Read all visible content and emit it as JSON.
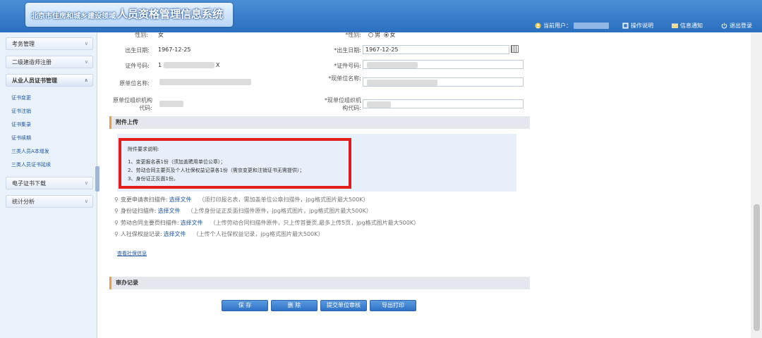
{
  "header": {
    "title_small": "北京市住房和城乡建设领域",
    "title_big": "人员资格管理信息系统",
    "current_user_label": "当前用户：",
    "help_label": "操作说明",
    "notice_label": "信息通知",
    "logout_label": "退出登录"
  },
  "sidebar": {
    "exam": "考务管理",
    "builder": "二级建造师注册",
    "cert_mgmt": "从业人员证书管理",
    "sub": [
      "证书变更",
      "证书注销",
      "证书集录",
      "证书续期",
      "三类人员A本增发",
      "三类人员证书延续"
    ],
    "e_cert": "电子证书下载",
    "stats": "统计分析"
  },
  "form": {
    "gender_label": "性别:",
    "gender_value": "女",
    "gender_label2": "*性别:",
    "male": "男",
    "female": "女",
    "birth_label": "出生日期:",
    "birth_value": "1967-12-25",
    "birth_label2": "*出生日期:",
    "birth_field": "1967-12-25",
    "id_label": "证件号码:",
    "id_value_start": "1",
    "id_value_end": "X",
    "id_label2": "*证件号码:",
    "orig_unit_label": "原单位名称:",
    "cur_unit_label": "*现单位名称:",
    "orig_org_label": "原单位组织机构代码:",
    "cur_org_label": "*现单位组织机构代码:"
  },
  "attach": {
    "section_title": "附件上传",
    "note_title": "附件要求说明:",
    "notes": [
      "1、变更报名表1份（须加盖聘用单位公章）；",
      "2、劳动合同主要页及个人社保权益记录各1份（需京变更和注销证书无需提供）；",
      "3、身份证正反面1份。"
    ],
    "rows": [
      {
        "label": "变更申请表扫描件:",
        "pick": "选择文件",
        "hint": "（须打印报名表，需加盖单位公章扫描件，jpg格式图片最大500K）"
      },
      {
        "label": "身份证扫描件:",
        "pick": "选择文件",
        "hint": "（上传身份证正反面扫描件原件，jpg格式图片，jpg格式图片最大500K）"
      },
      {
        "label": "劳动合同主要页扫描件:",
        "pick": "选择文件",
        "hint": "（上传劳动合同扫描件原件，只上传首要页,最多上传5页，jpg格式图片最大500K）"
      },
      {
        "label": "人社保权益记录:",
        "pick": "选择文件",
        "hint": "（上传个人社保权益记录，jpg格式图片最大500K）"
      }
    ],
    "view_link": "查看社保信息"
  },
  "review": {
    "section_title": "审办记录"
  },
  "buttons": {
    "save": "保 存",
    "delete": "删 除",
    "submit": "提交单位审核",
    "export": "导出打印"
  }
}
